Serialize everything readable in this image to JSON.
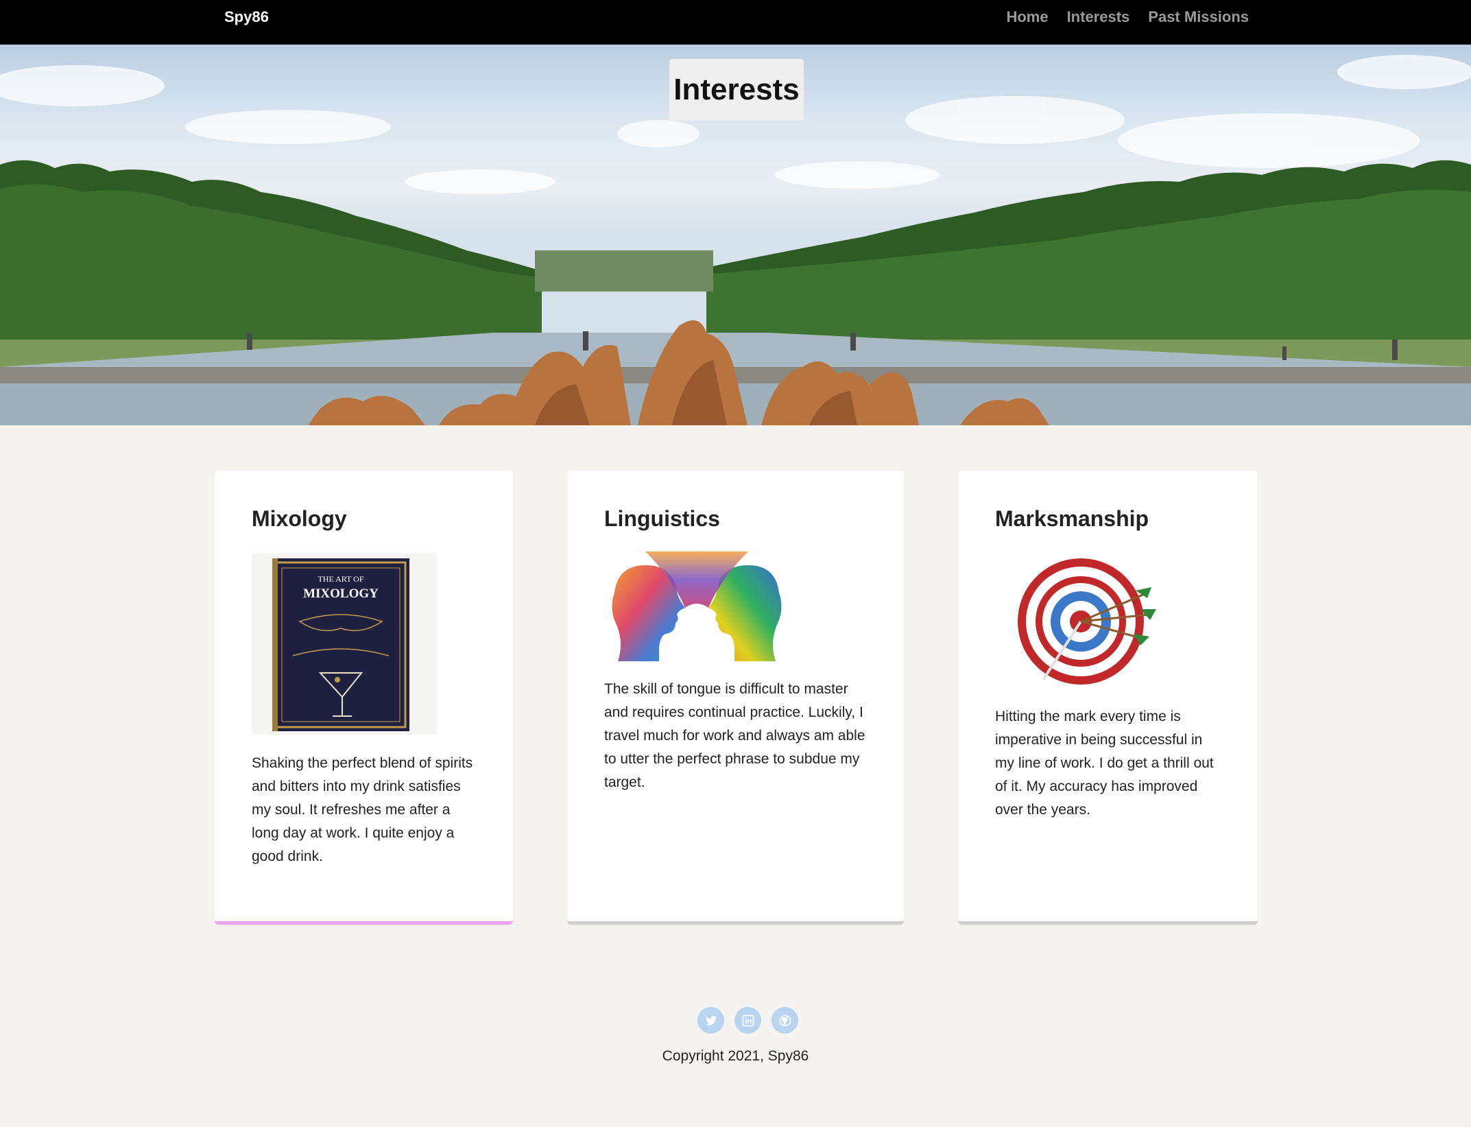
{
  "nav": {
    "brand": "Spy86",
    "links": [
      {
        "label": "Home"
      },
      {
        "label": "Interests"
      },
      {
        "label": "Past Missions"
      }
    ]
  },
  "hero": {
    "title": "Interests"
  },
  "cards": [
    {
      "title": "Mixology",
      "image_text_line1": "THE ART OF",
      "image_text_line2": "MIXOLOGY",
      "text": "Shaking the perfect blend of spirits and bitters into my drink satisfies my soul. It refreshes me after a long day at work. I quite enjoy a good drink."
    },
    {
      "title": "Linguistics",
      "text": "The skill of tongue is difficult to master and requires continual practice. Luckily, I travel much for work and always am able to utter the perfect phrase to subdue my target."
    },
    {
      "title": "Marksmanship",
      "text": "Hitting the mark every time is imperative in being successful in my line of work. I do get a thrill out of it. My accuracy has improved over the years."
    }
  ],
  "footer": {
    "social": [
      {
        "icon": "twitter-icon"
      },
      {
        "icon": "linkedin-icon"
      },
      {
        "icon": "github-icon"
      }
    ],
    "copyright": "Copyright 2021, Spy86"
  },
  "colors": {
    "navbar": "#000000",
    "page_background": "#f5f4f0",
    "card_active_border": "#f0a2f2",
    "card_border": "#cfcfcf",
    "social_icon_bg": "#b8d4f1"
  }
}
